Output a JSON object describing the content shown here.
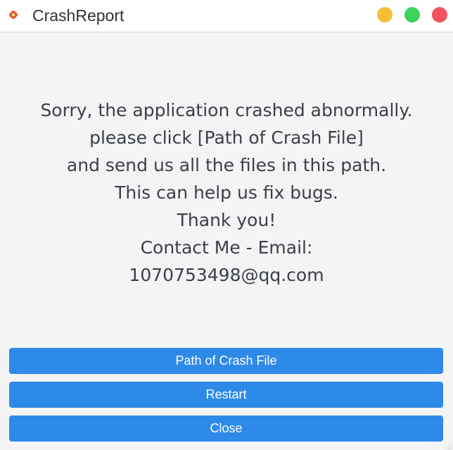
{
  "window": {
    "title": "CrashReport",
    "icon": "app-flower-icon",
    "controls": {
      "minimize": {
        "icon": "minimize-dot-icon",
        "color": "#f5be36"
      },
      "maximize": {
        "icon": "maximize-dot-icon",
        "color": "#3bd35a"
      },
      "close": {
        "icon": "close-dot-icon",
        "color": "#f2545e"
      }
    }
  },
  "message": {
    "lines": [
      "Sorry, the application crashed abnormally.",
      "please click [Path of Crash File]",
      "and send us all the files in this path.",
      "This can help us fix bugs.",
      "Thank you!",
      "Contact Me - Email:",
      "1070753498@qq.com"
    ]
  },
  "buttons": {
    "path_label": "Path of Crash File",
    "restart_label": "Restart",
    "close_label": "Close"
  },
  "colors": {
    "accent": "#2d8ae9",
    "background": "#f4f4f5",
    "text": "#3a3f4a"
  }
}
